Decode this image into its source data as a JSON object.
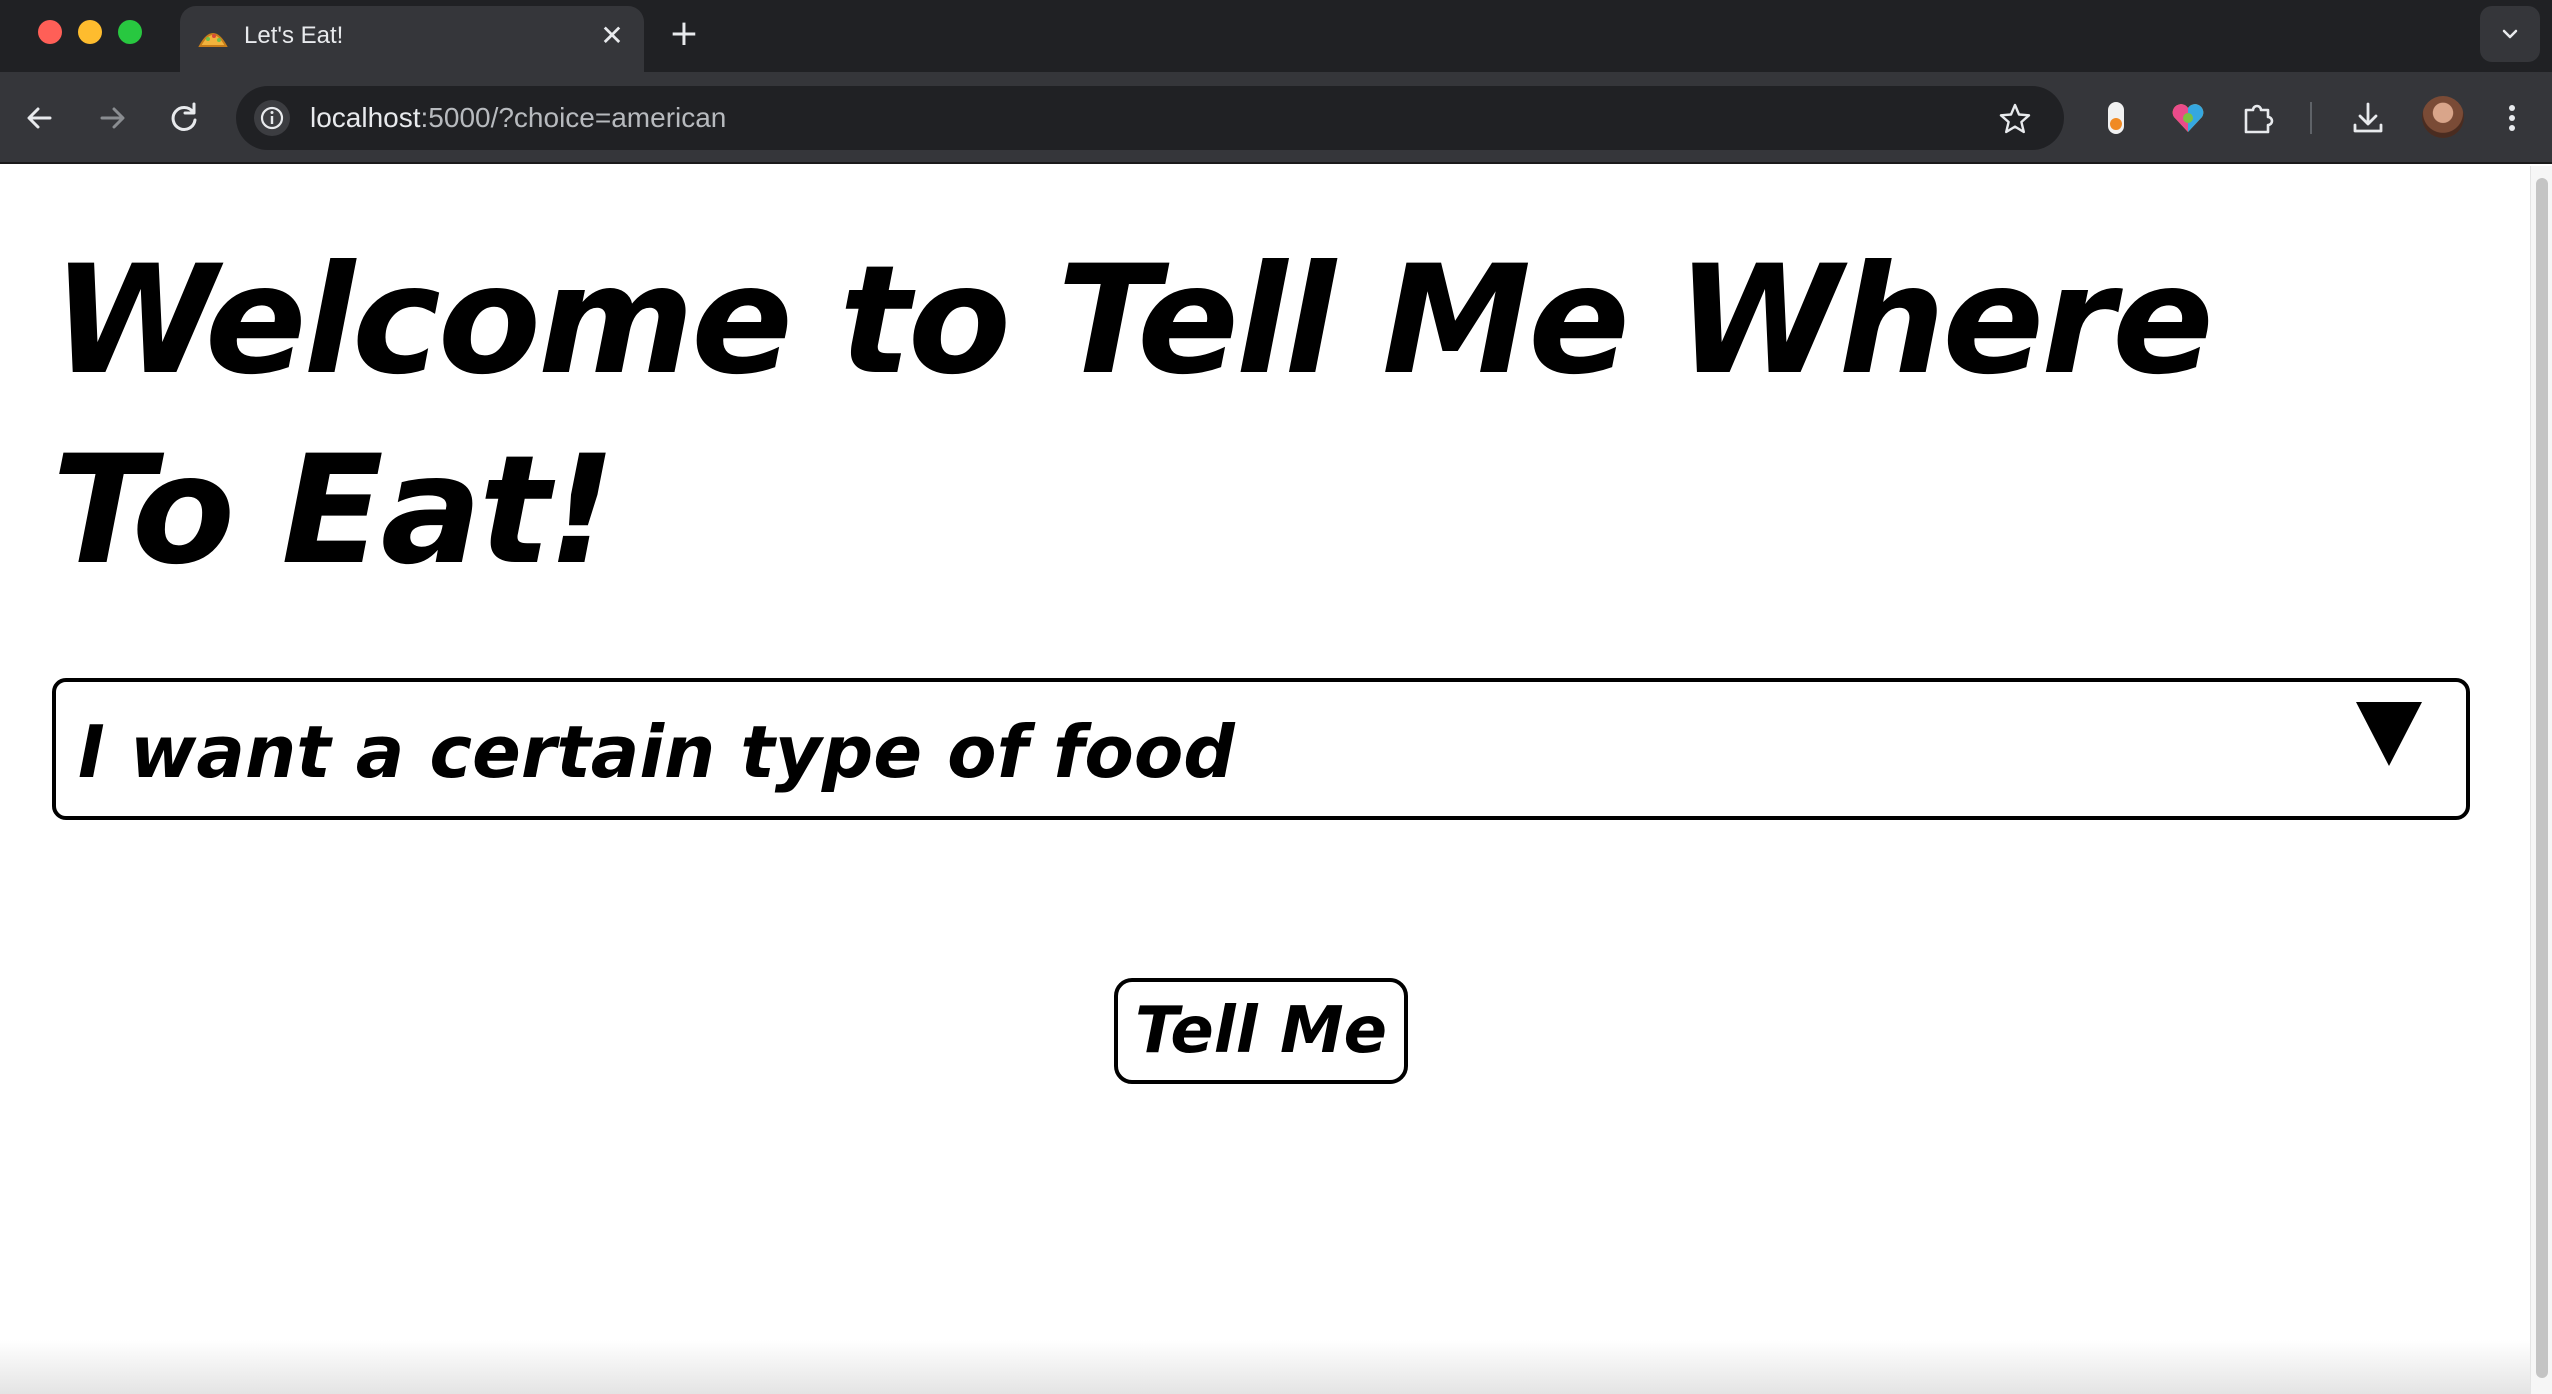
{
  "browser": {
    "tab": {
      "title": "Let's Eat!",
      "favicon": "taco-icon",
      "close_glyph": "✕"
    },
    "new_tab_glyph": "+",
    "address": {
      "host": "localhost",
      "path": ":5000/?choice=american"
    },
    "toolbar_icons": [
      "back-icon",
      "forward-icon",
      "reload-icon",
      "info-icon",
      "bookmark-star-icon",
      "extension-toggle-icon",
      "heart-extension-icon",
      "puzzle-extensions-icon",
      "download-icon",
      "profile-avatar",
      "kebab-menu-icon"
    ]
  },
  "page": {
    "headline": "Welcome to Tell Me Where To Eat!",
    "select": {
      "selected": "I want a certain type of food",
      "arrow_glyph": "▼"
    },
    "submit_label": "Tell Me"
  },
  "colors": {
    "chrome_dark": "#202124",
    "chrome_toolbar": "#35363a",
    "text_light": "#e8eaed",
    "page_bg": "#ffffff",
    "ink": "#000000"
  }
}
